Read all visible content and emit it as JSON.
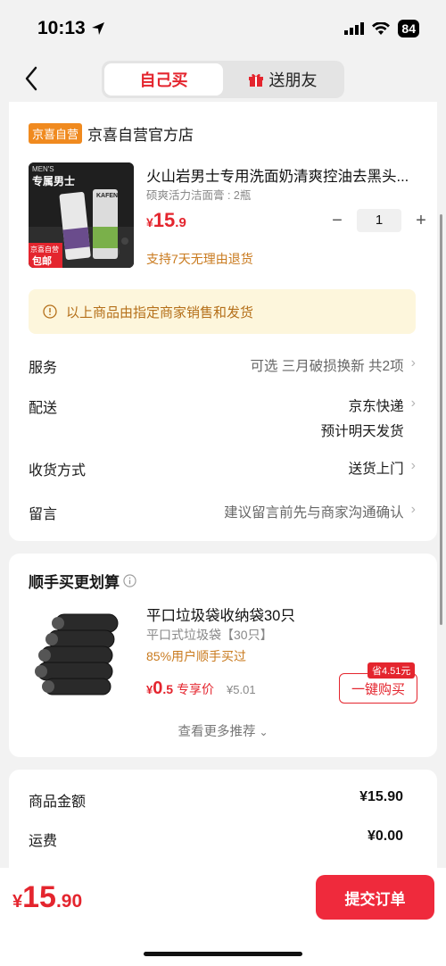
{
  "status": {
    "time": "10:13",
    "battery": "84"
  },
  "header": {
    "tabs": [
      {
        "label": "自己买"
      },
      {
        "label": "送朋友"
      }
    ]
  },
  "shop": {
    "badge": "京喜自营",
    "name": "京喜自营官方店"
  },
  "product": {
    "title": "火山岩男士专用洗面奶清爽控油去黑头...",
    "spec": "硕爽活力洁面膏 : 2瓶",
    "price_currency": "¥",
    "price_int": "15",
    "price_dec": ".9",
    "quantity": "1",
    "minus": "−",
    "plus": "+",
    "return_note": "支持7天无理由退货",
    "image_text": {
      "men": "MEN'S",
      "title": "专属男士",
      "brand": "KAFEN",
      "tag1": "京喜自营",
      "tag2": "包邮"
    }
  },
  "notice": {
    "text": "以上商品由指定商家销售和发货"
  },
  "rows": {
    "service": {
      "label": "服务",
      "value": "可选 三月破损换新 共2项"
    },
    "delivery": {
      "label": "配送",
      "line1": "京东快递",
      "line2": "预计明天发货"
    },
    "receive": {
      "label": "收货方式",
      "value": "送货上门"
    },
    "message": {
      "label": "留言",
      "value": "建议留言前先与商家沟通确认"
    }
  },
  "recommend": {
    "title": "顺手买更划算",
    "name": "平口垃圾袋收纳袋30只",
    "spec": "平口式垃圾袋【30只】",
    "note": "85%用户顺手买过",
    "price_currency": "¥",
    "price_int": "0",
    "price_dec": ".5",
    "price_tag": "专享价",
    "orig_price": "¥5.01",
    "save_badge": "省4.51元",
    "buy_label": "一键购买",
    "more": "查看更多推荐"
  },
  "summary": {
    "goods_label": "商品金额",
    "goods_value": "¥15.90",
    "ship_label": "运费",
    "ship_value": "¥0.00"
  },
  "bottom": {
    "currency": "¥",
    "int": "15",
    "dec": ".90",
    "submit_label": "提交订单"
  },
  "colors": {
    "accent": "#e4252e",
    "orange": "#c97a1e",
    "notice_bg": "#fdf6dc"
  }
}
